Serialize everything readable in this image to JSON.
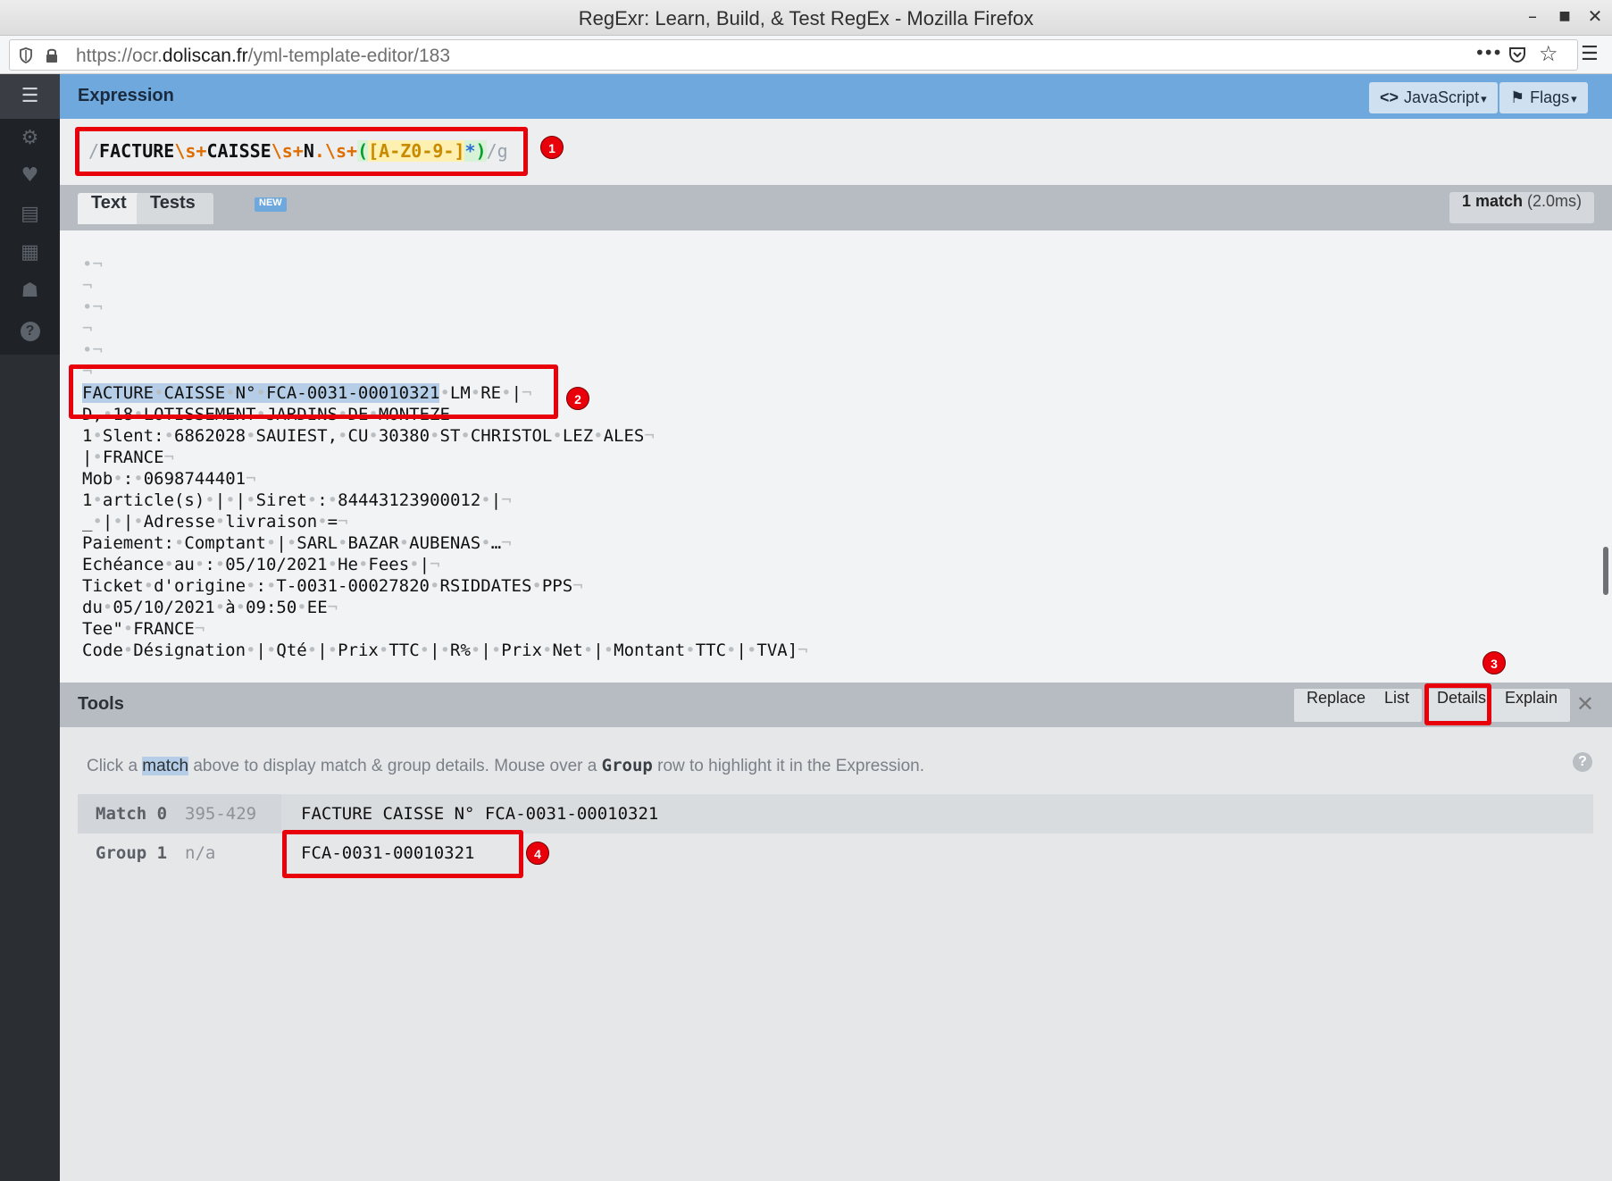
{
  "window": {
    "title": "RegExr: Learn, Build, & Test RegEx - Mozilla Firefox",
    "minimize": "–",
    "maximize": "■",
    "close": "✕"
  },
  "browser": {
    "url_prefix": "https://ocr.",
    "url_domain": "doliscan.fr",
    "url_path": "/yml-template-editor/183",
    "more_label": "•••",
    "pocket_label": "♡",
    "star_label": "☆",
    "menu_label": "☰"
  },
  "sidebar": {
    "items": [
      {
        "name": "list-icon",
        "glyph": "☰"
      },
      {
        "name": "gear-icon",
        "glyph": "⚙"
      },
      {
        "name": "heart-icon",
        "glyph": "♥"
      },
      {
        "name": "cheatsheet-icon",
        "glyph": "▤"
      },
      {
        "name": "reference-icon",
        "glyph": "▦"
      },
      {
        "name": "community-icon",
        "glyph": "☗"
      },
      {
        "name": "help-icon",
        "glyph": "?"
      }
    ]
  },
  "expression": {
    "header": "Expression",
    "language_button": "JavaScript",
    "language_icon": "<>",
    "flags_button": "Flags",
    "flags_icon": "⚑",
    "dropdown_caret": "▾",
    "parts": {
      "open_slash": "/",
      "t1": "FACTURE",
      "e1": "\\s+",
      "t2": "CAISSE",
      "e2": "\\s+",
      "t3": "N",
      "e3": ".\\s+",
      "g_open": "(",
      "set": "[A-Z0-9-]",
      "quant": "*",
      "g_close": ")",
      "close_slash": "/",
      "flag": "g"
    }
  },
  "tabs": {
    "text": "Text",
    "tests": "Tests",
    "new_badge": "NEW",
    "match_count_bold": "1 match",
    "match_time": " (2.0ms)"
  },
  "text_lines": [
    {
      "pre": "•",
      "eol": "¬"
    },
    {
      "pre": "",
      "eol": "¬"
    },
    {
      "pre": "•",
      "eol": "¬"
    },
    {
      "pre": "",
      "eol": "¬"
    },
    {
      "pre": "•",
      "eol": "¬"
    },
    {
      "pre": "",
      "eol": "¬"
    },
    {
      "match": "FACTURE•CAISSE•N°•FCA-0031-00010321",
      "rest": "•LM•RE•|",
      "eol": "¬"
    },
    {
      "rest": "D,•18•LOTISSEMENT•JARDINS•DE•MONTEZE",
      "eol": ""
    },
    {
      "rest": "1•Slent:•6862028•SAUIEST,•CU•30380•ST•CHRISTOL•LEZ•ALES",
      "eol": "¬"
    },
    {
      "rest": "|•FRANCE",
      "eol": "¬"
    },
    {
      "rest": "Mob•:•0698744401",
      "eol": "¬"
    },
    {
      "rest": "1•article(s)•|•|•Siret•:•84443123900012•|",
      "eol": "¬"
    },
    {
      "rest": "_•|•|•Adresse•livraison•=",
      "eol": "¬"
    },
    {
      "rest": "Paiement:•Comptant•|•SARL•BAZAR•AUBENAS•…",
      "eol": "¬"
    },
    {
      "rest": "Echéance•au•:•05/10/2021•He•Fees•|",
      "eol": "¬"
    },
    {
      "rest": "Ticket•d'origine•:•T-0031-00027820•RSIDDATES•PPS",
      "eol": "¬"
    },
    {
      "rest": "du•05/10/2021•à•09:50•EE",
      "eol": "¬"
    },
    {
      "rest": "Tee\"•FRANCE",
      "eol": "¬"
    },
    {
      "rest": "Code•Désignation•|•Qté•|•Prix•TTC•|•R%•|•Prix•Net•|•Montant•TTC•|•TVA]",
      "eol": "¬"
    }
  ],
  "tools": {
    "header": "Tools",
    "replace": "Replace",
    "list": "List",
    "details": "Details",
    "explain": "Explain",
    "close": "✕",
    "hint_pre": "Click a ",
    "hint_match": "match",
    "hint_mid": " above to display match & group details. Mouse over a ",
    "hint_group": "Group",
    "hint_post": " row to highlight it in the Expression.",
    "help": "?"
  },
  "details": {
    "match": {
      "label": "Match 0",
      "range": "395-429",
      "value": "FACTURE CAISSE N° FCA-0031-00010321"
    },
    "group": {
      "label": "Group 1",
      "range": "n/a",
      "value": "FCA-0031-00010321"
    }
  },
  "annotations": [
    "1",
    "2",
    "3",
    "4"
  ]
}
